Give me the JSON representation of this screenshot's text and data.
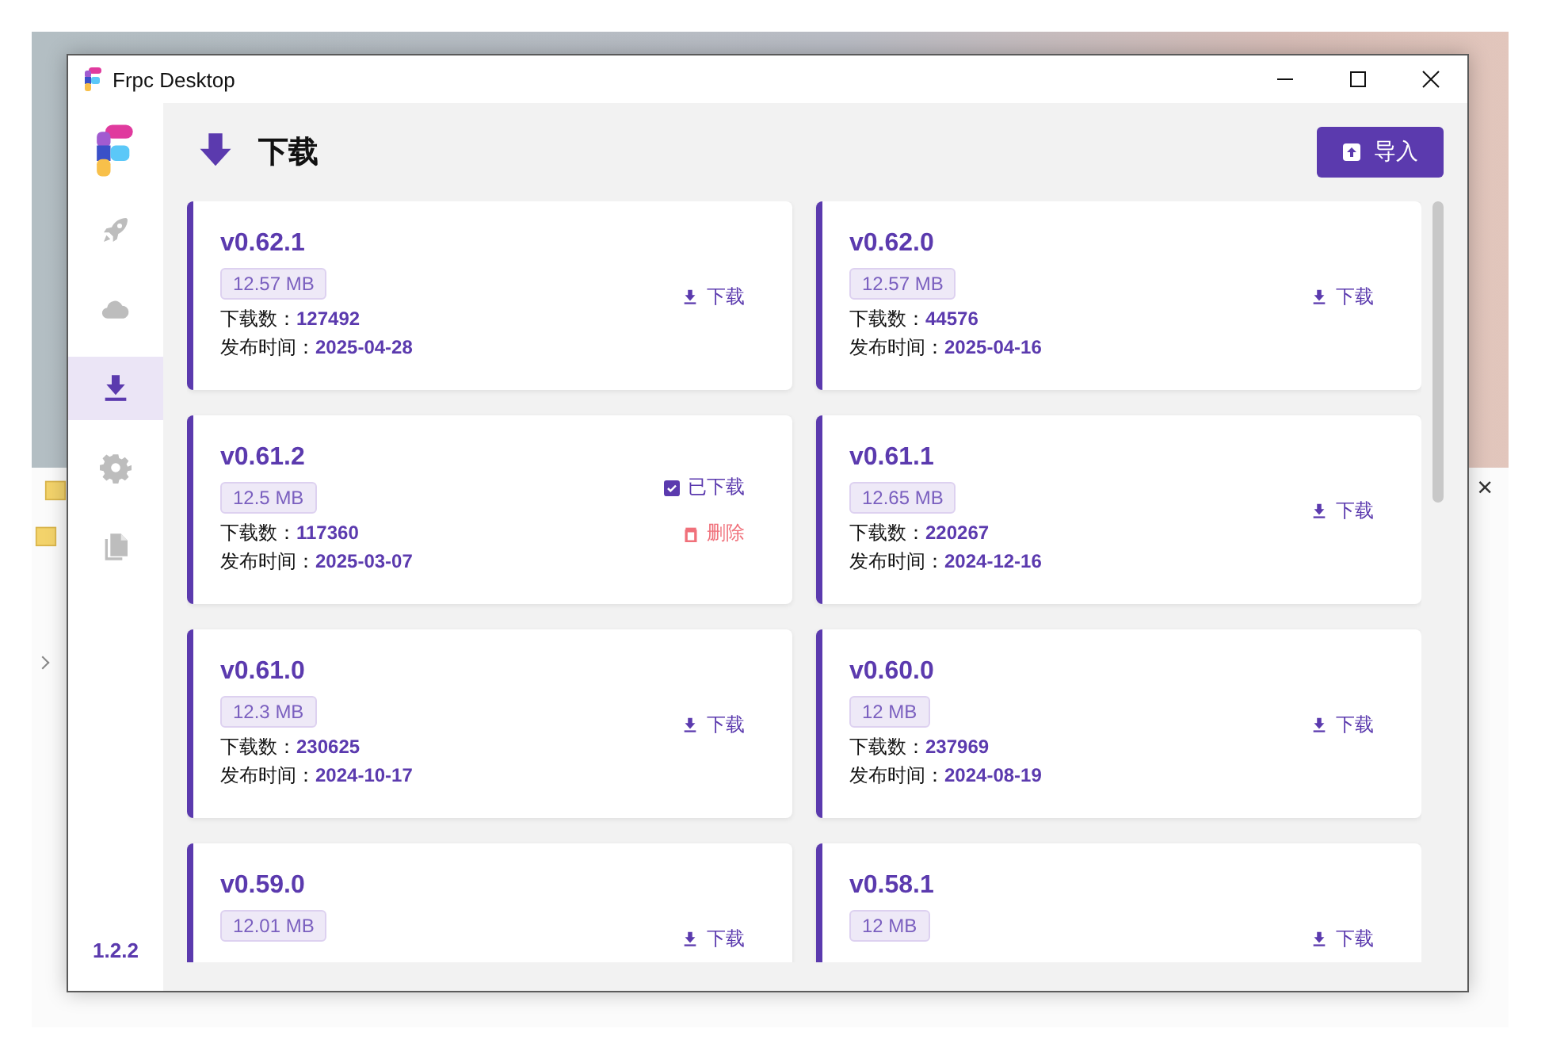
{
  "background_window": {
    "items": [
      {
        "kind": "folder"
      },
      {
        "kind": "folder"
      },
      {
        "kind": "path"
      }
    ],
    "close": "×"
  },
  "window": {
    "title": "Frpc Desktop",
    "controls": [
      {
        "kind": "minimize"
      },
      {
        "kind": "maximize"
      },
      {
        "kind": "close"
      }
    ]
  },
  "sidebar": {
    "items": [
      {
        "kind": "logo"
      },
      {
        "kind": "rocket",
        "selected": false
      },
      {
        "kind": "cloud",
        "selected": false
      },
      {
        "kind": "download",
        "selected": true
      },
      {
        "kind": "gear",
        "selected": false
      },
      {
        "kind": "copy",
        "selected": false
      }
    ],
    "version": "1.2.2"
  },
  "header": {
    "title": "下载",
    "import_button": "导入"
  },
  "releases": [
    {
      "version": "v0.62.1",
      "size": "12.57 MB",
      "downloads_label": "下载数：",
      "downloads": "127492",
      "date_label": "发布时间：",
      "date": "2025-04-28",
      "actions": [
        {
          "kind": "download",
          "label": "下载"
        }
      ]
    },
    {
      "version": "v0.62.0",
      "size": "12.57 MB",
      "downloads_label": "下载数：",
      "downloads": "44576",
      "date_label": "发布时间：",
      "date": "2025-04-16",
      "actions": [
        {
          "kind": "download",
          "label": "下载"
        }
      ]
    },
    {
      "version": "v0.61.2",
      "size": "12.5 MB",
      "downloads_label": "下载数：",
      "downloads": "117360",
      "date_label": "发布时间：",
      "date": "2025-03-07",
      "actions": [
        {
          "kind": "downloaded",
          "label": "已下载"
        },
        {
          "kind": "delete",
          "label": "删除"
        }
      ]
    },
    {
      "version": "v0.61.1",
      "size": "12.65 MB",
      "downloads_label": "下载数：",
      "downloads": "220267",
      "date_label": "发布时间：",
      "date": "2024-12-16",
      "actions": [
        {
          "kind": "download",
          "label": "下载"
        }
      ]
    },
    {
      "version": "v0.61.0",
      "size": "12.3 MB",
      "downloads_label": "下载数：",
      "downloads": "230625",
      "date_label": "发布时间：",
      "date": "2024-10-17",
      "actions": [
        {
          "kind": "download",
          "label": "下载"
        }
      ]
    },
    {
      "version": "v0.60.0",
      "size": "12 MB",
      "downloads_label": "下载数：",
      "downloads": "237969",
      "date_label": "发布时间：",
      "date": "2024-08-19",
      "actions": [
        {
          "kind": "download",
          "label": "下载"
        }
      ]
    },
    {
      "version": "v0.59.0",
      "size": "12.01 MB",
      "actions": [
        {
          "kind": "download",
          "label": "下载"
        }
      ]
    },
    {
      "version": "v0.58.1",
      "size": "12 MB",
      "actions": [
        {
          "kind": "download",
          "label": "下载"
        }
      ]
    }
  ]
}
